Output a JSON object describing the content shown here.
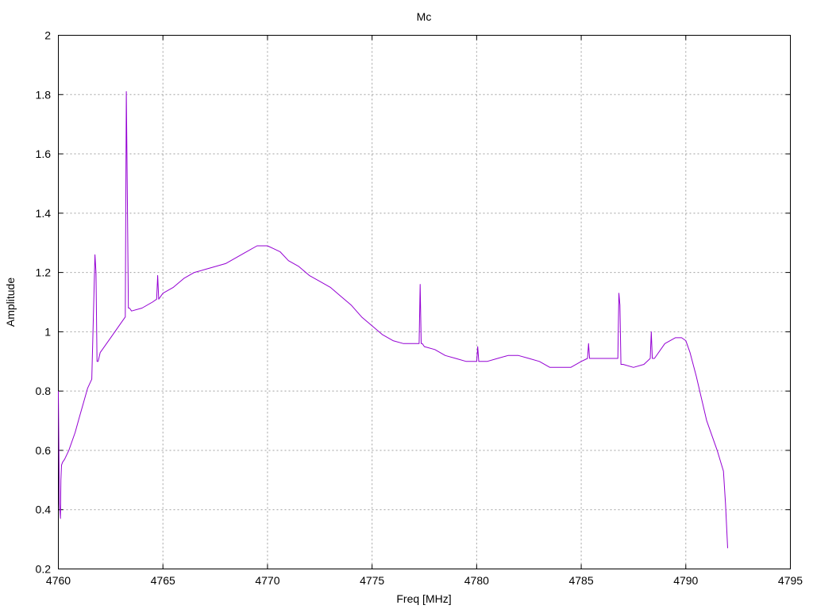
{
  "chart_data": {
    "type": "line",
    "title": "Mc",
    "xlabel": "Freq [MHz]",
    "ylabel": "Amplitude",
    "xlim": [
      4760,
      4795
    ],
    "ylim": [
      0.2,
      2.0
    ],
    "xticks": [
      4760,
      4765,
      4770,
      4775,
      4780,
      4785,
      4790,
      4795
    ],
    "yticks": [
      0.2,
      0.4,
      0.6,
      0.8,
      1.0,
      1.2,
      1.4,
      1.6,
      1.8,
      2.0
    ],
    "ytick_labels": [
      "0.2",
      "0.4",
      "0.6",
      "0.8",
      "1",
      "1.2",
      "1.4",
      "1.6",
      "1.8",
      "2"
    ],
    "grid": true,
    "series": [
      {
        "color": "#9400d3",
        "x": [
          4760.0,
          4760.05,
          4760.1,
          4760.12,
          4760.15,
          4760.2,
          4760.3,
          4760.5,
          4760.8,
          4761.0,
          4761.2,
          4761.4,
          4761.6,
          4761.75,
          4761.8,
          4761.85,
          4761.9,
          4762.0,
          4762.5,
          4763.0,
          4763.2,
          4763.25,
          4763.3,
          4763.35,
          4763.4,
          4763.5,
          4764.0,
          4764.5,
          4764.7,
          4764.75,
          4764.8,
          4765.0,
          4765.5,
          4766.0,
          4766.5,
          4767.0,
          4767.5,
          4768.0,
          4768.5,
          4769.0,
          4769.5,
          4770.0,
          4770.3,
          4770.6,
          4771.0,
          4771.5,
          4772.0,
          4772.5,
          4773.0,
          4773.5,
          4774.0,
          4774.5,
          4775.0,
          4775.5,
          4776.0,
          4776.5,
          4777.0,
          4777.25,
          4777.3,
          4777.35,
          4777.4,
          4777.5,
          4778.0,
          4778.5,
          4779.0,
          4779.5,
          4780.0,
          4780.05,
          4780.1,
          4780.5,
          4781.0,
          4781.5,
          4782.0,
          4782.5,
          4783.0,
          4783.5,
          4784.0,
          4784.5,
          4785.0,
          4785.3,
          4785.35,
          4785.4,
          4785.5,
          4786.0,
          4786.5,
          4786.75,
          4786.8,
          4786.85,
          4786.9,
          4787.0,
          4787.5,
          4788.0,
          4788.3,
          4788.35,
          4788.4,
          4788.5,
          4789.0,
          4789.5,
          4789.8,
          4790.0,
          4790.2,
          4790.5,
          4791.0,
          4791.5,
          4791.8,
          4791.9,
          4792.0
        ],
        "y": [
          0.8,
          0.42,
          0.37,
          0.5,
          0.55,
          0.56,
          0.57,
          0.6,
          0.66,
          0.71,
          0.76,
          0.81,
          0.84,
          1.26,
          1.2,
          0.9,
          0.9,
          0.93,
          0.98,
          1.03,
          1.05,
          1.81,
          1.46,
          1.08,
          1.08,
          1.07,
          1.08,
          1.1,
          1.11,
          1.19,
          1.11,
          1.13,
          1.15,
          1.18,
          1.2,
          1.21,
          1.22,
          1.23,
          1.25,
          1.27,
          1.29,
          1.29,
          1.28,
          1.27,
          1.24,
          1.22,
          1.19,
          1.17,
          1.15,
          1.12,
          1.09,
          1.05,
          1.02,
          0.99,
          0.97,
          0.96,
          0.96,
          0.96,
          1.16,
          0.96,
          0.96,
          0.95,
          0.94,
          0.92,
          0.91,
          0.9,
          0.9,
          0.95,
          0.9,
          0.9,
          0.91,
          0.92,
          0.92,
          0.91,
          0.9,
          0.88,
          0.88,
          0.88,
          0.9,
          0.91,
          0.96,
          0.91,
          0.91,
          0.91,
          0.91,
          0.91,
          1.13,
          1.09,
          0.89,
          0.89,
          0.88,
          0.89,
          0.91,
          1.0,
          0.91,
          0.91,
          0.96,
          0.98,
          0.98,
          0.97,
          0.93,
          0.85,
          0.7,
          0.6,
          0.53,
          0.42,
          0.27
        ]
      }
    ]
  }
}
